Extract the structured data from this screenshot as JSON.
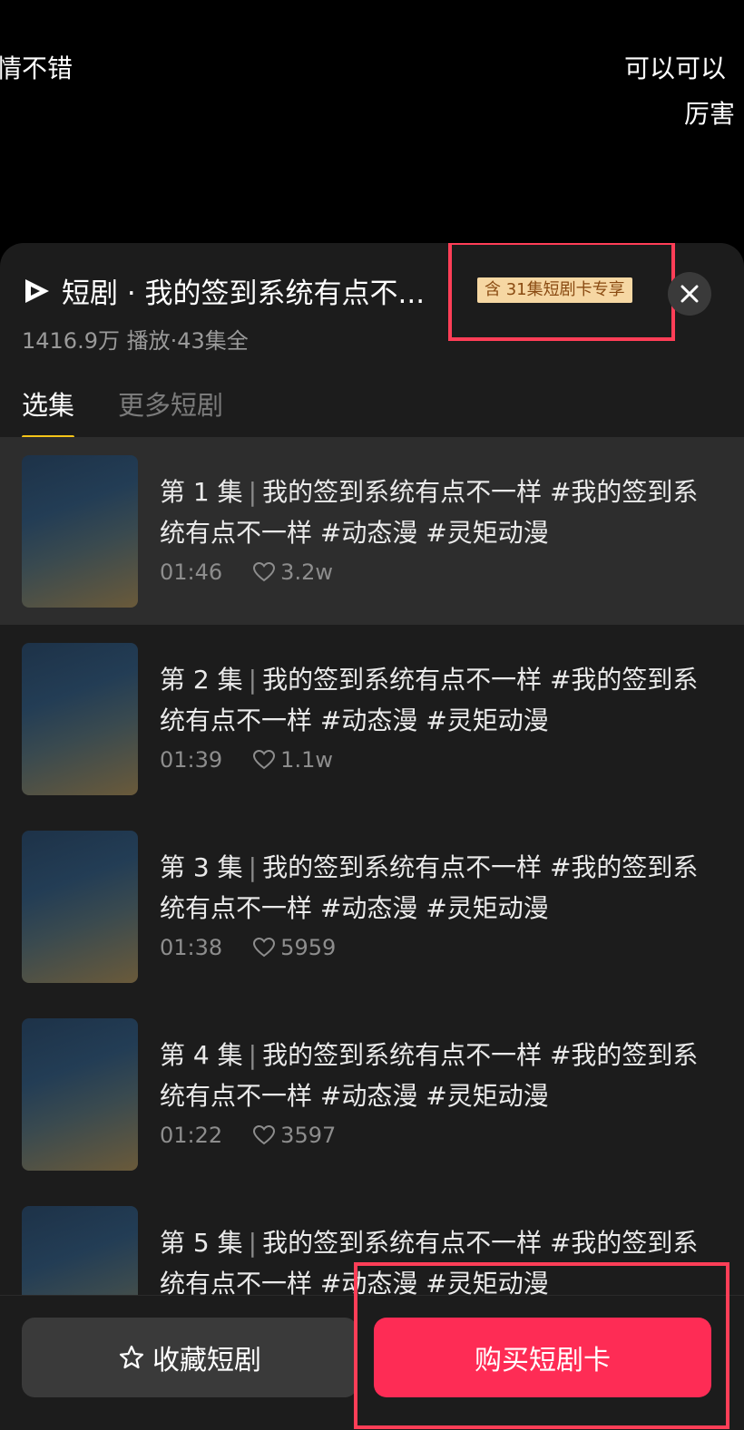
{
  "danmaku": {
    "left_line": "情不错",
    "right_line_1": "可以可以",
    "right_line_2": "厉害"
  },
  "drama": {
    "title": "短剧 · 我的签到系统有点不...",
    "badge": "含 31集短剧卡专享",
    "stats": "1416.9万 播放·43集全"
  },
  "tabs": [
    {
      "label": "选集",
      "active": true
    },
    {
      "label": "更多短剧",
      "active": false
    }
  ],
  "episodes": [
    {
      "num": "第 1 集",
      "sep": "|",
      "title": "我的签到系统有点不一样 #我的签到系统有点不一样 #动态漫 #灵矩动漫",
      "duration": "01:46",
      "likes": "3.2w"
    },
    {
      "num": "第 2 集",
      "sep": "|",
      "title": "我的签到系统有点不一样 #我的签到系统有点不一样 #动态漫 #灵矩动漫",
      "duration": "01:39",
      "likes": "1.1w"
    },
    {
      "num": "第 3 集",
      "sep": "|",
      "title": "我的签到系统有点不一样 #我的签到系统有点不一样 #动态漫 #灵矩动漫",
      "duration": "01:38",
      "likes": "5959"
    },
    {
      "num": "第 4 集",
      "sep": "|",
      "title": "我的签到系统有点不一样 #我的签到系统有点不一样 #动态漫 #灵矩动漫",
      "duration": "01:22",
      "likes": "3597"
    },
    {
      "num": "第 5 集",
      "sep": "|",
      "title": "我的签到系统有点不一样 #我的签到系统有点不一样 #动态漫 #灵矩动漫",
      "duration": "",
      "likes": ""
    }
  ],
  "buttons": {
    "favorite": "收藏短剧",
    "buy": "购买短剧卡"
  },
  "icons": {
    "logo": "short-drama-logo-icon",
    "close": "close-icon",
    "heart": "heart-icon",
    "star": "star-icon"
  },
  "colors": {
    "accent": "#fe2c55",
    "tab_underline": "#f5c518",
    "badge_bg": "#f6d7a3",
    "highlight": "#ff3e57"
  }
}
